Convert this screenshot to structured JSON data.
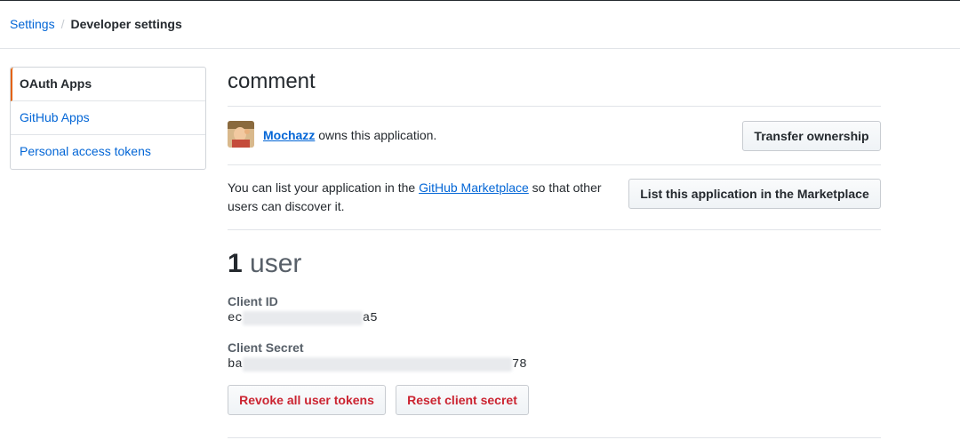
{
  "breadcrumb": {
    "parent": "Settings",
    "separator": "/",
    "current": "Developer settings"
  },
  "sidebar": {
    "items": [
      {
        "label": "OAuth Apps",
        "selected": true
      },
      {
        "label": "GitHub Apps",
        "selected": false
      },
      {
        "label": "Personal access tokens",
        "selected": false
      }
    ]
  },
  "app": {
    "name": "comment",
    "owner": {
      "username": "Mochazz",
      "suffix": " owns this application."
    },
    "transfer_button": "Transfer ownership",
    "marketplace": {
      "text_before": "You can list your application in the ",
      "link": "GitHub Marketplace",
      "text_after": " so that other users can discover it.",
      "button": "List this application in the Marketplace"
    },
    "user_count": {
      "number": "1",
      "label": " user"
    },
    "client_id": {
      "label": "Client ID",
      "prefix": "ec",
      "suffix": "a5"
    },
    "client_secret": {
      "label": "Client Secret",
      "prefix": "ba",
      "suffix": "78"
    },
    "revoke_button": "Revoke all user tokens",
    "reset_button": "Reset client secret"
  },
  "colors": {
    "link": "#0366d6",
    "danger": "#cb2431",
    "selected_accent": "#e36209"
  }
}
